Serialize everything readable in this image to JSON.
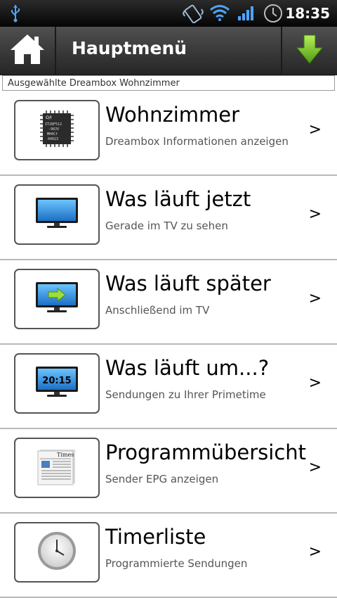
{
  "status_bar": {
    "time": "18:35",
    "icons": [
      "usb-icon",
      "vibrate-icon",
      "wifi-icon",
      "signal-icon",
      "alarm-clock-icon"
    ]
  },
  "header": {
    "title": "Hauptmenü",
    "home_icon": "home-icon",
    "download_icon": "arrow-down-icon"
  },
  "selection": {
    "label": "Ausgewählte Dreambox Wohnzimmer"
  },
  "menu": {
    "items": [
      {
        "title": "Wohnzimmer",
        "subtitle": "Dreambox Informationen anzeigen",
        "chevron": ">",
        "icon": "chip-icon",
        "chip_text": [
          "IT28F512",
          "-90JV",
          "MH4Cf",
          "04023"
        ]
      },
      {
        "title": "Was läuft jetzt",
        "subtitle": "Gerade im TV zu sehen",
        "chevron": ">",
        "icon": "tv-icon"
      },
      {
        "title": "Was läuft später",
        "subtitle": "Anschließend im TV",
        "chevron": ">",
        "icon": "tv-arrow-icon"
      },
      {
        "title": "Was läuft um...?",
        "subtitle": "Sendungen zu Ihrer Primetime",
        "chevron": ">",
        "icon": "tv-clock-icon",
        "clock_text": "20:15"
      },
      {
        "title": "Programmübersicht",
        "subtitle": "Sender EPG anzeigen",
        "chevron": ">",
        "icon": "newspaper-icon",
        "paper_text": "Times"
      },
      {
        "title": "Timerliste",
        "subtitle": "Programmierte Sendungen",
        "chevron": ">",
        "icon": "clock-icon"
      }
    ]
  },
  "colors": {
    "header_bg": "#3a3a3a",
    "status_bg": "#000000",
    "tv_screen": "#3aa0e8",
    "arrow_green": "#7fc62a"
  }
}
